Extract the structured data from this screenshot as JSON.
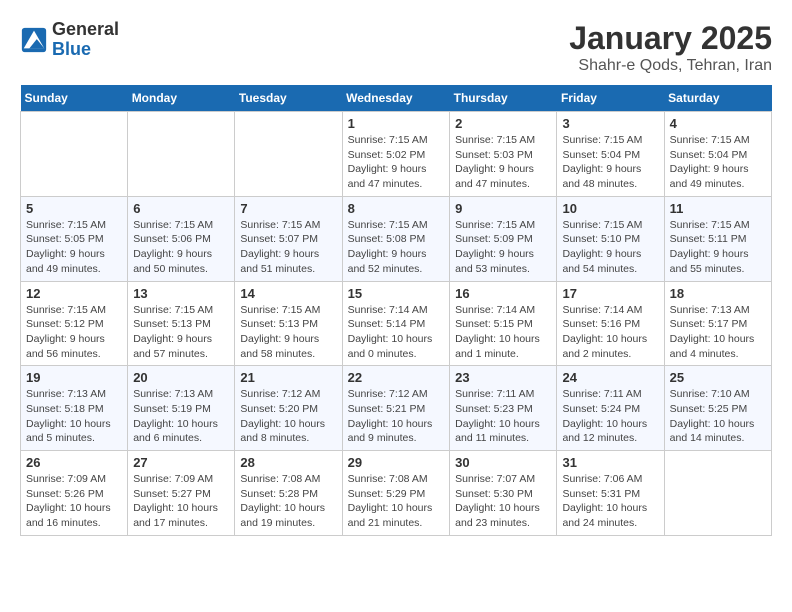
{
  "header": {
    "logo_general": "General",
    "logo_blue": "Blue",
    "month_title": "January 2025",
    "subtitle": "Shahr-e Qods, Tehran, Iran"
  },
  "days_of_week": [
    "Sunday",
    "Monday",
    "Tuesday",
    "Wednesday",
    "Thursday",
    "Friday",
    "Saturday"
  ],
  "weeks": [
    [
      {
        "day": "",
        "info": ""
      },
      {
        "day": "",
        "info": ""
      },
      {
        "day": "",
        "info": ""
      },
      {
        "day": "1",
        "info": "Sunrise: 7:15 AM\nSunset: 5:02 PM\nDaylight: 9 hours\nand 47 minutes."
      },
      {
        "day": "2",
        "info": "Sunrise: 7:15 AM\nSunset: 5:03 PM\nDaylight: 9 hours\nand 47 minutes."
      },
      {
        "day": "3",
        "info": "Sunrise: 7:15 AM\nSunset: 5:04 PM\nDaylight: 9 hours\nand 48 minutes."
      },
      {
        "day": "4",
        "info": "Sunrise: 7:15 AM\nSunset: 5:04 PM\nDaylight: 9 hours\nand 49 minutes."
      }
    ],
    [
      {
        "day": "5",
        "info": "Sunrise: 7:15 AM\nSunset: 5:05 PM\nDaylight: 9 hours\nand 49 minutes."
      },
      {
        "day": "6",
        "info": "Sunrise: 7:15 AM\nSunset: 5:06 PM\nDaylight: 9 hours\nand 50 minutes."
      },
      {
        "day": "7",
        "info": "Sunrise: 7:15 AM\nSunset: 5:07 PM\nDaylight: 9 hours\nand 51 minutes."
      },
      {
        "day": "8",
        "info": "Sunrise: 7:15 AM\nSunset: 5:08 PM\nDaylight: 9 hours\nand 52 minutes."
      },
      {
        "day": "9",
        "info": "Sunrise: 7:15 AM\nSunset: 5:09 PM\nDaylight: 9 hours\nand 53 minutes."
      },
      {
        "day": "10",
        "info": "Sunrise: 7:15 AM\nSunset: 5:10 PM\nDaylight: 9 hours\nand 54 minutes."
      },
      {
        "day": "11",
        "info": "Sunrise: 7:15 AM\nSunset: 5:11 PM\nDaylight: 9 hours\nand 55 minutes."
      }
    ],
    [
      {
        "day": "12",
        "info": "Sunrise: 7:15 AM\nSunset: 5:12 PM\nDaylight: 9 hours\nand 56 minutes."
      },
      {
        "day": "13",
        "info": "Sunrise: 7:15 AM\nSunset: 5:13 PM\nDaylight: 9 hours\nand 57 minutes."
      },
      {
        "day": "14",
        "info": "Sunrise: 7:15 AM\nSunset: 5:13 PM\nDaylight: 9 hours\nand 58 minutes."
      },
      {
        "day": "15",
        "info": "Sunrise: 7:14 AM\nSunset: 5:14 PM\nDaylight: 10 hours\nand 0 minutes."
      },
      {
        "day": "16",
        "info": "Sunrise: 7:14 AM\nSunset: 5:15 PM\nDaylight: 10 hours\nand 1 minute."
      },
      {
        "day": "17",
        "info": "Sunrise: 7:14 AM\nSunset: 5:16 PM\nDaylight: 10 hours\nand 2 minutes."
      },
      {
        "day": "18",
        "info": "Sunrise: 7:13 AM\nSunset: 5:17 PM\nDaylight: 10 hours\nand 4 minutes."
      }
    ],
    [
      {
        "day": "19",
        "info": "Sunrise: 7:13 AM\nSunset: 5:18 PM\nDaylight: 10 hours\nand 5 minutes."
      },
      {
        "day": "20",
        "info": "Sunrise: 7:13 AM\nSunset: 5:19 PM\nDaylight: 10 hours\nand 6 minutes."
      },
      {
        "day": "21",
        "info": "Sunrise: 7:12 AM\nSunset: 5:20 PM\nDaylight: 10 hours\nand 8 minutes."
      },
      {
        "day": "22",
        "info": "Sunrise: 7:12 AM\nSunset: 5:21 PM\nDaylight: 10 hours\nand 9 minutes."
      },
      {
        "day": "23",
        "info": "Sunrise: 7:11 AM\nSunset: 5:23 PM\nDaylight: 10 hours\nand 11 minutes."
      },
      {
        "day": "24",
        "info": "Sunrise: 7:11 AM\nSunset: 5:24 PM\nDaylight: 10 hours\nand 12 minutes."
      },
      {
        "day": "25",
        "info": "Sunrise: 7:10 AM\nSunset: 5:25 PM\nDaylight: 10 hours\nand 14 minutes."
      }
    ],
    [
      {
        "day": "26",
        "info": "Sunrise: 7:09 AM\nSunset: 5:26 PM\nDaylight: 10 hours\nand 16 minutes."
      },
      {
        "day": "27",
        "info": "Sunrise: 7:09 AM\nSunset: 5:27 PM\nDaylight: 10 hours\nand 17 minutes."
      },
      {
        "day": "28",
        "info": "Sunrise: 7:08 AM\nSunset: 5:28 PM\nDaylight: 10 hours\nand 19 minutes."
      },
      {
        "day": "29",
        "info": "Sunrise: 7:08 AM\nSunset: 5:29 PM\nDaylight: 10 hours\nand 21 minutes."
      },
      {
        "day": "30",
        "info": "Sunrise: 7:07 AM\nSunset: 5:30 PM\nDaylight: 10 hours\nand 23 minutes."
      },
      {
        "day": "31",
        "info": "Sunrise: 7:06 AM\nSunset: 5:31 PM\nDaylight: 10 hours\nand 24 minutes."
      },
      {
        "day": "",
        "info": ""
      }
    ]
  ]
}
